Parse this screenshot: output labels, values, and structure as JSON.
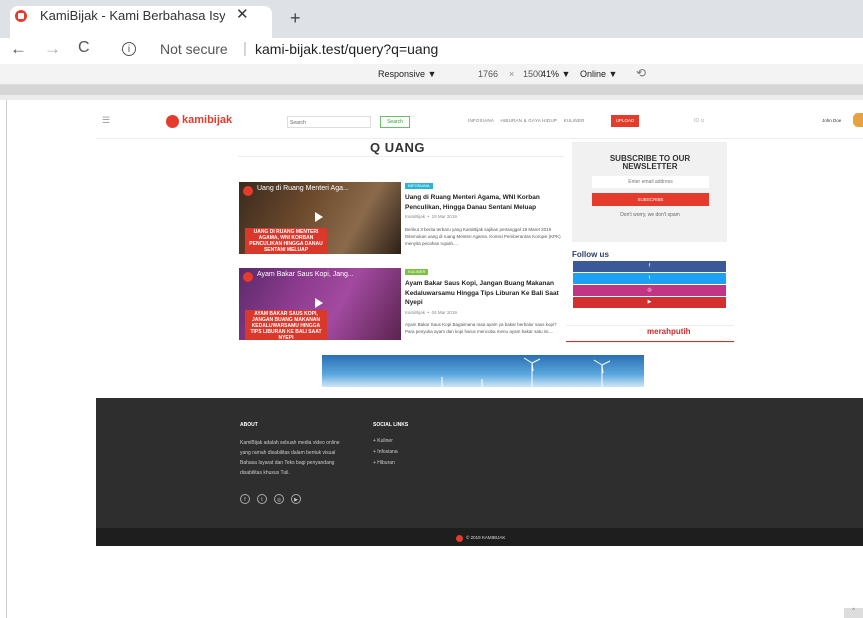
{
  "browser": {
    "tab_title": "KamiBijak - Kami Berbahasa Isyar",
    "tab_close": "✕",
    "new_tab": "+",
    "back": "←",
    "forward": "→",
    "reload": "C",
    "info": "i",
    "not_secure": "Not secure",
    "separator": "|",
    "url": "kami-bijak.test/query?q=uang"
  },
  "devtools": {
    "responsive": "Responsive ▼",
    "width": "1766",
    "x": "×",
    "height": "1500",
    "zoom": "41% ▼",
    "network": "Online ▼",
    "rotate_icon": "⟲"
  },
  "site": {
    "hamburger": "☰",
    "logo_text": "kamibijak",
    "search_placeholder": "Search",
    "search_button": "Search",
    "nav": [
      "INFOSIANA",
      "HIBURAN & GAYA HIDUP",
      "KULINER"
    ],
    "upload": "UPLOAD",
    "lang": "ID ⊙",
    "user_name": "John Doe"
  },
  "main": {
    "search_icon": "Q",
    "search_title": "UANG",
    "articles": [
      {
        "thumb_title": "Uang di Ruang Menteri Aga...",
        "thumb_caption": "UANG DI RUANG MENTERI AGAMA, WNI KORBAN PENCULIKAN HINGGA DANAU SENTANI MELUAP",
        "badge": "INFOSIANA",
        "badge_color": "#29b6d6",
        "title": "Uang di Ruang Menteri Agama, WNI Korban Penculikan, Hingga Danau Sentani Meluap",
        "author": "KamiBijak",
        "date": "19 Mar 2019",
        "desc": "Berikut 3 berita terbaru yang KamiBijak sajikan pertanggal 19 Maret 2019 Ditemukan uang di ruang Menteri Agama. Komisi Pemberantas Korupsi (KPK) menyita pecahan rupiah...."
      },
      {
        "thumb_title": "Ayam Bakar Saus Kopi, Jang...",
        "thumb_caption": "AYAM BAKAR SAUS KOPI, JANGAN BUANG MAKANAN KEDALUWARSAMU HINGGA TIPS LIBURAN KE BALI SAAT NYEPI",
        "badge": "KULINER",
        "badge_color": "#7cc242",
        "title": "Ayam Bakar Saus Kopi, Jangan Buang Makanan Kedaluwarsamu Hingga Tips Liburan Ke Bali Saat Nyepi",
        "author": "KamiBijak",
        "date": "04 Mar 2019",
        "desc": "Ayam Bakar Saus Kopi Bagaimana rasa ayam ya bakar berbalur saus kopi? Para penyuka ayam dan kopi harus mencoba menu ayam bakar satu ini...."
      }
    ]
  },
  "sidebar": {
    "newsletter_title": "SUBSCRIBE TO OUR NEWSLETTER",
    "email_placeholder": "Enter email address",
    "subscribe": "SUBSCRIBE",
    "note": "Don't worry, we don't spam",
    "follow_title": "Follow us",
    "social_buttons": [
      {
        "icon": "f",
        "color": "#3b5998"
      },
      {
        "icon": "t",
        "color": "#1da1f2"
      },
      {
        "icon": "◎",
        "color": "#c13584"
      },
      {
        "icon": "▶",
        "color": "#d32f2f"
      }
    ],
    "ad_text": "merahputih"
  },
  "footer": {
    "about_title": "ABOUT",
    "about_text": "KamiBijak adalah sebuah media video online yang ramah disabilitas dalam bentuk visual Bahasa Isyarat dan Teks bagi penyandang disabilitas khusus Tuli.",
    "social_title": "SOCIAL LINKS",
    "links": [
      "+ Kuliner",
      "+ Infosiana",
      "+ Hiburan"
    ],
    "icons": [
      "f",
      "t",
      "◎",
      "▶"
    ],
    "copyright": "© 2019 KAMIBIJAK",
    "scroll_top": "^"
  }
}
